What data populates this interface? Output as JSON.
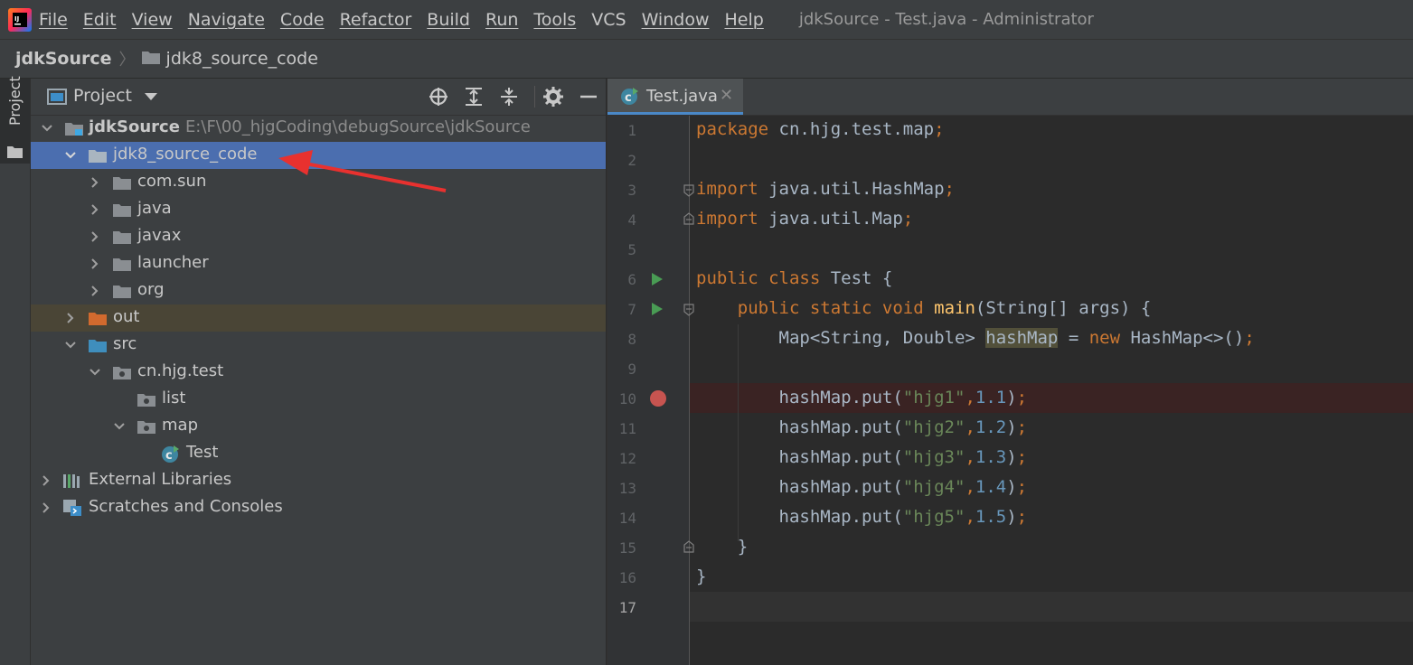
{
  "menubar": {
    "items": [
      "File",
      "Edit",
      "View",
      "Navigate",
      "Code",
      "Refactor",
      "Build",
      "Run",
      "Tools",
      "VCS",
      "Window",
      "Help"
    ],
    "window_title": "jdkSource - Test.java - Administrator",
    "logo_icon": "intellij-idea-icon"
  },
  "breadcrumb": {
    "root": "jdkSource",
    "folder": "jdk8_source_code"
  },
  "toolstrip": {
    "project_label": "Project"
  },
  "project_panel": {
    "title": "Project",
    "header_icons": [
      "locate-icon",
      "expand-all-icon",
      "collapse-all-icon",
      "gear-icon",
      "minimize-icon"
    ],
    "tree": [
      {
        "label": "jdkSource",
        "path": "E:\\F\\00_hjgCoding\\debugSource\\jdkSource",
        "expanded": true,
        "icon": "module-folder-icon",
        "selected": false
      },
      {
        "label": "jdk8_source_code",
        "expanded": true,
        "icon": "folder-icon",
        "selected": true
      },
      {
        "label": "com.sun",
        "expanded": false,
        "icon": "folder-icon"
      },
      {
        "label": "java",
        "expanded": false,
        "icon": "folder-icon"
      },
      {
        "label": "javax",
        "expanded": false,
        "icon": "folder-icon"
      },
      {
        "label": "launcher",
        "expanded": false,
        "icon": "folder-icon"
      },
      {
        "label": "org",
        "expanded": false,
        "icon": "folder-icon"
      },
      {
        "label": "out",
        "expanded": false,
        "icon": "excluded-folder-icon"
      },
      {
        "label": "src",
        "expanded": true,
        "icon": "source-folder-icon"
      },
      {
        "label": "cn.hjg.test",
        "expanded": true,
        "icon": "package-icon"
      },
      {
        "label": "list",
        "icon": "package-icon"
      },
      {
        "label": "map",
        "expanded": true,
        "icon": "package-icon"
      },
      {
        "label": "Test",
        "icon": "java-class-icon"
      },
      {
        "label": "External Libraries",
        "expanded": false,
        "icon": "libraries-icon"
      },
      {
        "label": "Scratches and Consoles",
        "expanded": false,
        "icon": "scratches-icon"
      }
    ]
  },
  "editor": {
    "tab": {
      "label": "Test.java",
      "close": "✕"
    },
    "line_numbers": [
      "1",
      "2",
      "3",
      "4",
      "5",
      "6",
      "7",
      "8",
      "9",
      "10",
      "11",
      "12",
      "13",
      "14",
      "15",
      "16",
      "17"
    ],
    "code": {
      "l1_kw": "package",
      "l1_rest": " cn.hjg.test.map",
      "semi": ";",
      "l3_kw": "import",
      "l3_rest": " java.util.HashMap",
      "l4_kw": "import",
      "l4_rest": " java.util.Map",
      "l6_kw": "public class",
      "l6_rest": " Test {",
      "l7_kw": "public static void",
      "l7_fn": "main",
      "l7_rest": "(String[] args) {",
      "l8_a": "Map<String, Double> ",
      "l8_var": "hashMap",
      "l8_b": " = ",
      "l8_kw": "new",
      "l8_c": " HashMap<>()",
      "put": "hashMap.put(",
      "strs": [
        "\"hjg1\"",
        "\"hjg2\"",
        "\"hjg3\"",
        "\"hjg4\"",
        "\"hjg5\""
      ],
      "nums": [
        "1.1",
        "1.2",
        "1.3",
        "1.4",
        "1.5"
      ],
      "comma": ",",
      "close_paren": ")",
      "l15": "}",
      "l16": "}"
    },
    "breakpoint_line": 10,
    "colors": {
      "keyword": "#cc7832",
      "string": "#6a8759",
      "number": "#6897bb",
      "function": "#ffc66d",
      "breakpoint": "#c75450",
      "run": "#499c54",
      "selection": "#4b6eaf"
    }
  }
}
